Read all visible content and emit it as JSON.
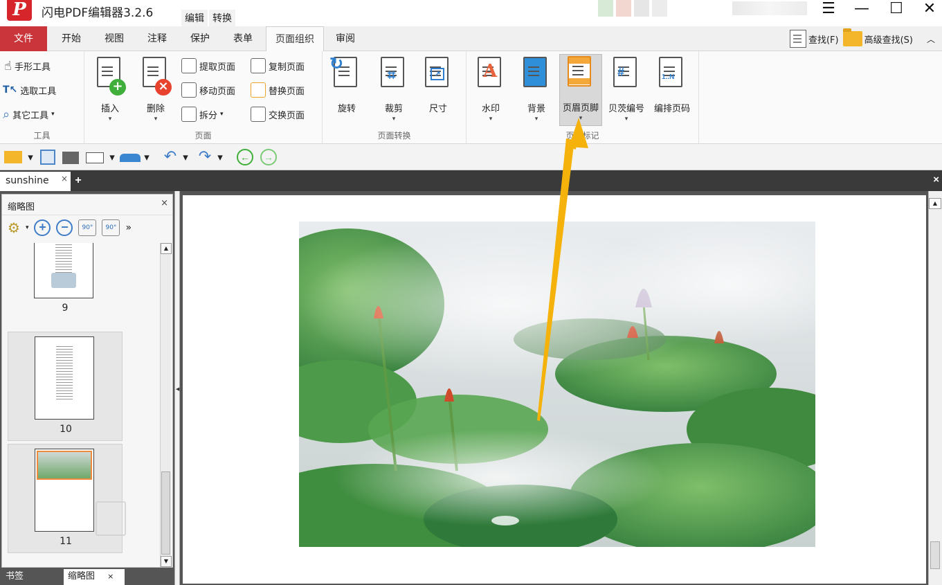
{
  "app": {
    "title": "闪电PDF编辑器3.2.6",
    "title_menu": [
      "编辑",
      "转换"
    ]
  },
  "window": {
    "menu_glyph": "☰",
    "minimize_glyph": "—",
    "maximize_glyph": "☐",
    "close_glyph": "✕"
  },
  "ribbon_tabs": [
    "文件",
    "开始",
    "视图",
    "注释",
    "保护",
    "表单",
    "页面组织",
    "审阅"
  ],
  "active_tab": "页面组织",
  "search": {
    "find_label": "查找(F)",
    "advanced_find_label": "高级查找(S)",
    "collapse_glyph": "︿"
  },
  "groups": {
    "tools": {
      "label": "工具",
      "items": [
        "手形工具",
        "选取工具",
        "其它工具"
      ]
    },
    "page": {
      "label": "页面",
      "insert": "插入",
      "delete": "删除",
      "small": [
        "提取页面",
        "复制页面",
        "移动页面",
        "替换页面",
        "拆分",
        "交换页面"
      ]
    },
    "page_transform": {
      "label": "页面转换",
      "items": [
        "旋转",
        "裁剪",
        "尺寸"
      ]
    },
    "page_mark": {
      "label": "页面标记",
      "items": [
        "水印",
        "背景",
        "页眉页脚",
        "贝茨编号",
        "编排页码"
      ],
      "selected": "页眉页脚"
    }
  },
  "quickbar_glyphs": {
    "undo": "↶",
    "redo": "↷",
    "back": "←",
    "forward": "→",
    "caret": "▾"
  },
  "document_tab": {
    "name": "sunshine",
    "close": "×",
    "add": "+",
    "close_all": "×"
  },
  "side_panel": {
    "title": "缩略图",
    "close": "×",
    "more": "»",
    "rotate_ccw": "90°",
    "rotate_cw": "90°",
    "zoom_in": "+",
    "zoom_out": "−",
    "thumbnails": [
      {
        "page": "9"
      },
      {
        "page": "10"
      },
      {
        "page": "11"
      }
    ],
    "bottom_tabs": [
      {
        "label": "书签",
        "close": "×"
      },
      {
        "label": "缩略图",
        "close": "×"
      }
    ]
  },
  "colors": {
    "file_tab": "#c9353a",
    "accent_blue": "#3e7cc8",
    "arrow": "#f5b20a",
    "logo_red": "#d6262b"
  }
}
